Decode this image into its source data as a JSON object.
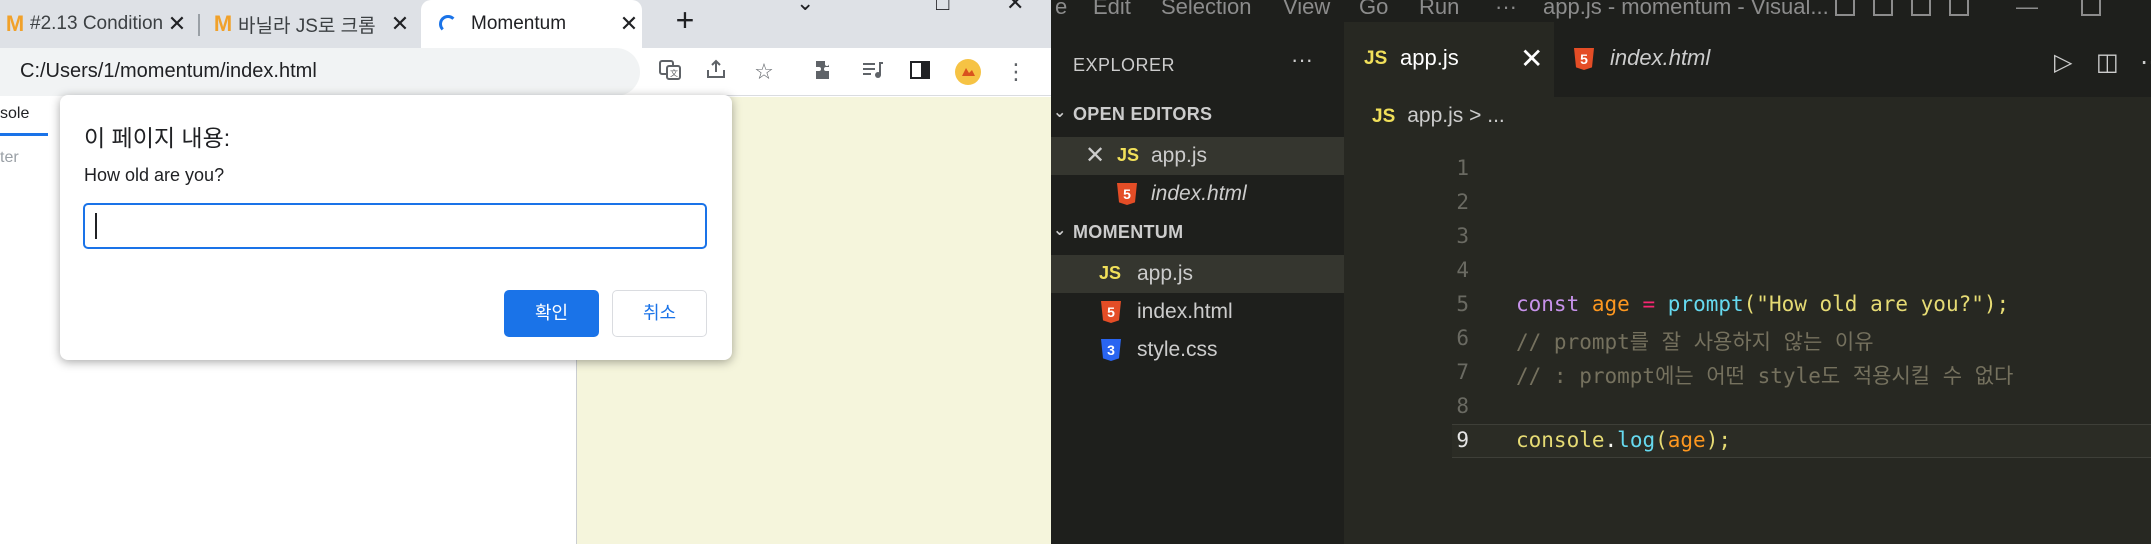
{
  "browser": {
    "tabs": [
      {
        "label": "#2.13 Condition",
        "favicon": "M"
      },
      {
        "label": "바닐라 JS로 크롬",
        "favicon": "M"
      },
      {
        "label": "Momentum",
        "favicon": "loading"
      }
    ],
    "new_tab": "+",
    "url": "C:/Users/1/momentum/index.html",
    "devtools": {
      "tab": "sole",
      "filter_placeholder": "ter"
    },
    "page_bg": "#f5f5dc"
  },
  "dialog": {
    "title": "이 페이지 내용:",
    "message": "How old are you?",
    "input_value": "",
    "ok_label": "확인",
    "cancel_label": "취소"
  },
  "vscode": {
    "menu": [
      "e",
      "Edit",
      "Selection",
      "View",
      "Go",
      "Run",
      "···"
    ],
    "title": "app.js - momentum - Visual...",
    "explorer": {
      "title": "EXPLORER",
      "more": "···",
      "open_editors_label": "OPEN EDITORS",
      "open_editors": [
        {
          "name": "app.js",
          "type": "js",
          "badge": "JS"
        },
        {
          "name": "index.html",
          "type": "html",
          "badge": "5"
        }
      ],
      "folder_label": "MOMENTUM",
      "files": [
        {
          "name": "app.js",
          "type": "js",
          "badge": "JS"
        },
        {
          "name": "index.html",
          "type": "html",
          "badge": "5"
        },
        {
          "name": "style.css",
          "type": "css",
          "badge": "3"
        }
      ]
    },
    "editor_tabs": [
      {
        "name": "app.js",
        "badge": "JS"
      },
      {
        "name": "index.html",
        "badge": "5"
      }
    ],
    "breadcrumb": {
      "badge": "JS",
      "file": "app.js",
      "sep": ">",
      "rest": "..."
    },
    "line_numbers": [
      "1",
      "2",
      "3",
      "4",
      "5",
      "6",
      "7",
      "8",
      "9"
    ],
    "code": {
      "l5": {
        "kw": "const",
        "var": "age",
        "op": "=",
        "fn": "prompt",
        "open": "(",
        "str": "\"How old are you?\"",
        "close": ");"
      },
      "l6": "// prompt를 잘 사용하지 않는 이유",
      "l7": "// : prompt에는 어떤 style도 적용시킬 수 없다",
      "l9": {
        "obj": "console",
        "dot": ".",
        "fn": "log",
        "open": "(",
        "arg": "age",
        "close": ");"
      }
    },
    "colors": {
      "editor_bg": "#272822",
      "sidebar_bg": "#1e1f1c"
    }
  }
}
